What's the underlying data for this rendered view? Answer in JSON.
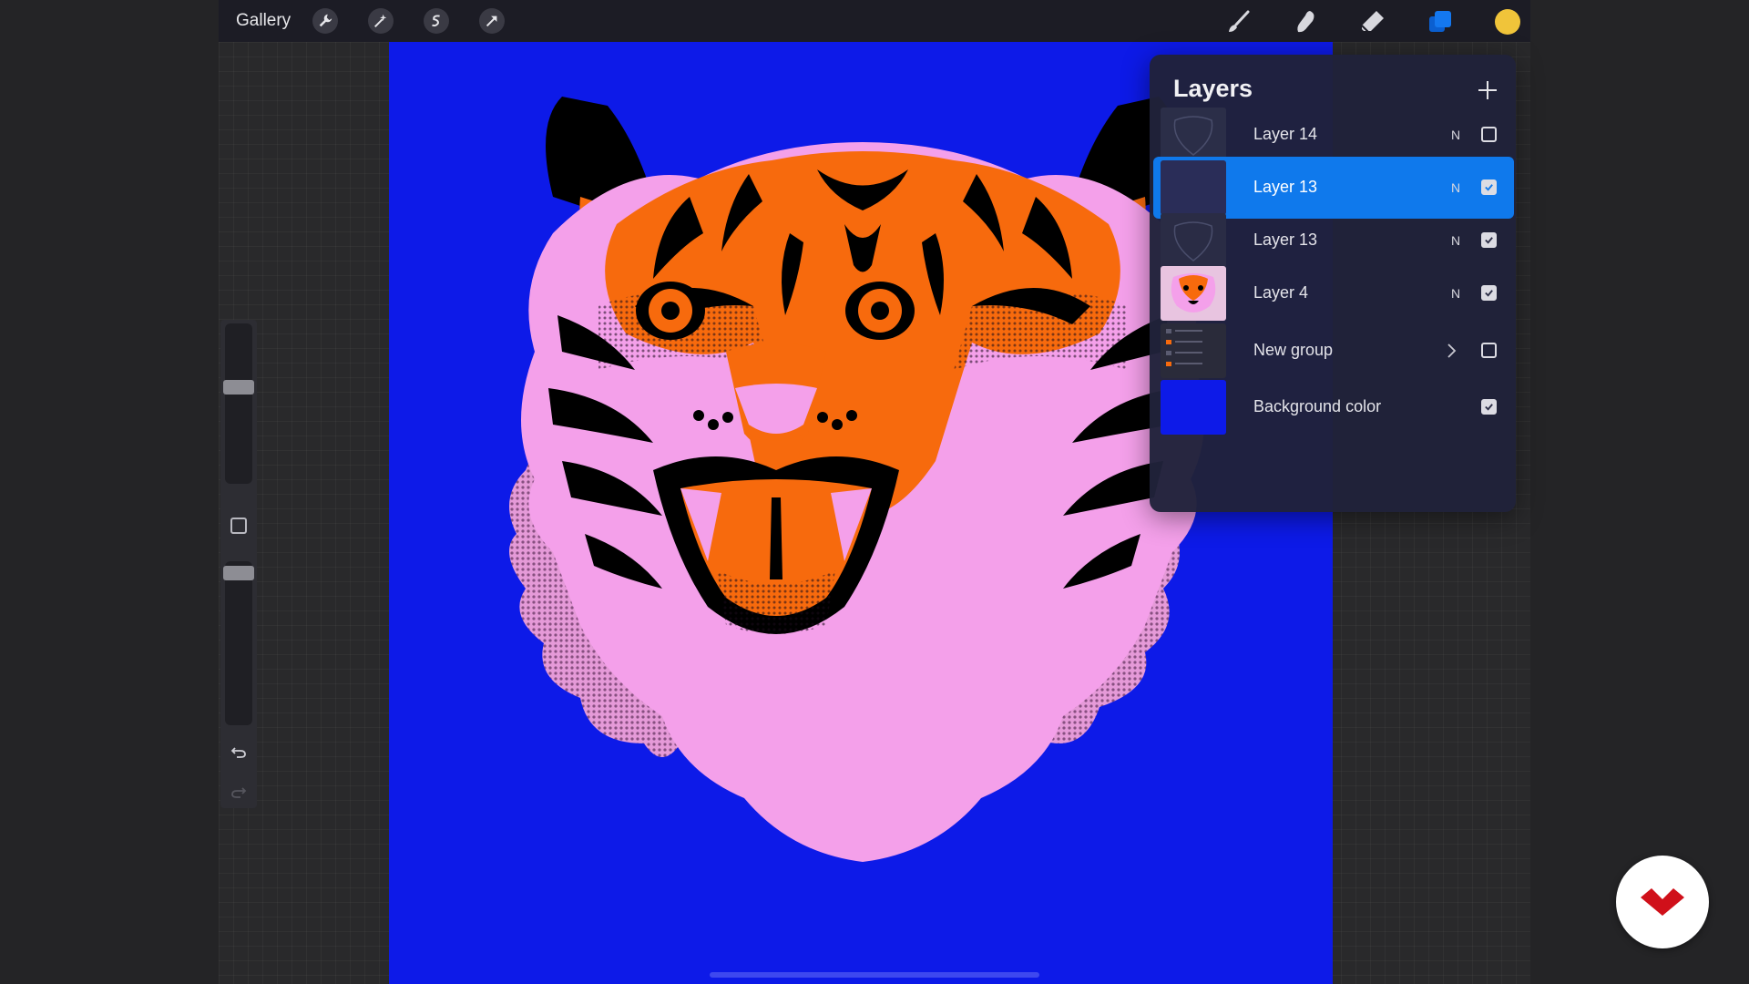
{
  "toolbar": {
    "gallery_label": "Gallery",
    "left_tools": [
      "wrench-icon",
      "magic-wand-icon",
      "selection-icon",
      "transform-arrow-icon"
    ],
    "right_tools": [
      "brush-icon",
      "smudge-icon",
      "eraser-icon",
      "layers-icon"
    ],
    "current_color": "#f0c43a"
  },
  "canvas": {
    "background_color": "#0d1ae8"
  },
  "layers_panel": {
    "title": "Layers",
    "layers": [
      {
        "name": "Layer 14",
        "blend": "N",
        "visible": false,
        "selected": false,
        "thumb": "sketch"
      },
      {
        "name": "Layer 13",
        "blend": "N",
        "visible": true,
        "selected": true,
        "thumb": "empty"
      },
      {
        "name": "Layer 13",
        "blend": "N",
        "visible": true,
        "selected": false,
        "thumb": "dark"
      },
      {
        "name": "Layer 4",
        "blend": "N",
        "visible": true,
        "selected": false,
        "thumb": "tiger"
      },
      {
        "name": "New group",
        "blend": "",
        "visible": false,
        "selected": false,
        "thumb": "group",
        "is_group": true
      },
      {
        "name": "Background color",
        "blend": "",
        "visible": true,
        "selected": false,
        "thumb": "blue"
      }
    ]
  },
  "colors": {
    "accent_blue": "#0f79ec",
    "tiger_orange": "#f76a0d",
    "tiger_pink": "#f4a0ea",
    "logo_red": "#d0101a"
  }
}
